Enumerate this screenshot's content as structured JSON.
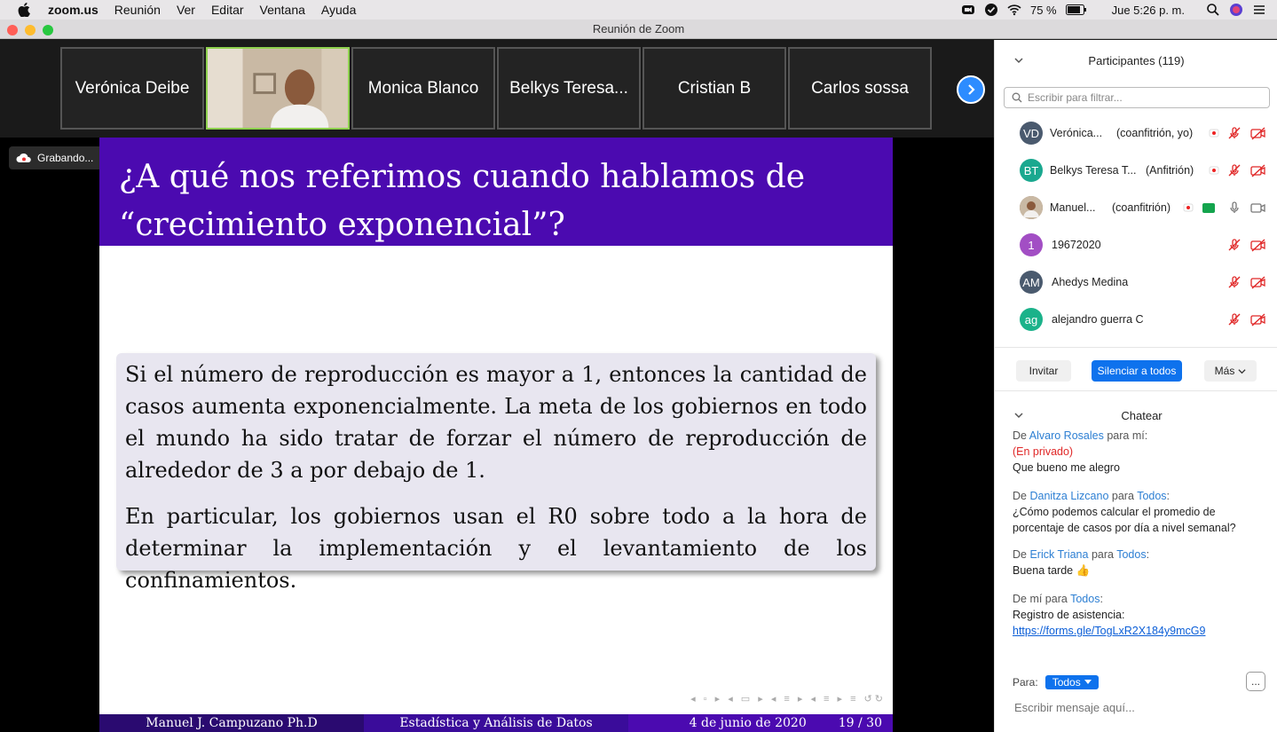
{
  "menubar": {
    "app": "zoom.us",
    "menus": [
      "Reunión",
      "Ver",
      "Editar",
      "Ventana",
      "Ayuda"
    ],
    "battery": "75 %",
    "clock": "Jue 5:26 p. m."
  },
  "window": {
    "title": "Reunión de Zoom"
  },
  "gallery": {
    "tiles": [
      "Verónica Deibe",
      "",
      "Monica Blanco",
      "Belkys Teresa...",
      "Cristian B",
      "Carlos sossa"
    ]
  },
  "recording": {
    "label": "Grabando..."
  },
  "slide": {
    "title_line1": "¿A qué nos referimos cuando hablamos de",
    "title_line2": "“crecimiento exponencial”?",
    "para1": "Si el número de reproducción es mayor a 1, entonces la cantidad de casos aumenta exponencialmente. La meta de los gobiernos en todo el mundo ha sido tratar de forzar el número de reproducción de alrededor de 3 a por debajo de 1.",
    "para2": "En particular, los gobiernos usan el R0 sobre todo a la hora de determinar la implementación y el levantamiento de los confinamientos.",
    "footer_author": "Manuel J. Campuzano Ph.D",
    "footer_course": "Estadística y Análisis de Datos",
    "footer_date": "4 de junio de 2020",
    "footer_page": "19 / 30"
  },
  "participants": {
    "title": "Participantes (119)",
    "filter_placeholder": "Escribir para filtrar...",
    "list": [
      {
        "initials": "VD",
        "name": "Verónica...",
        "role": "(coanfitrión, yo)",
        "color": "#4a5a6e"
      },
      {
        "initials": "BT",
        "name": "Belkys Teresa T...",
        "role": "(Anfitrión)",
        "color": "#1aa88f"
      },
      {
        "initials": "",
        "name": "Manuel...",
        "role": "(coanfitrión)",
        "color": "#8a6a50"
      },
      {
        "initials": "1",
        "name": "19672020",
        "role": "",
        "color": "#a24ec4"
      },
      {
        "initials": "AM",
        "name": "Ahedys Medina",
        "role": "",
        "color": "#4a5a6e"
      },
      {
        "initials": "ag",
        "name": "alejandro guerra C",
        "role": "",
        "color": "#1bb28a"
      }
    ],
    "invite": "Invitar",
    "mute_all": "Silenciar a todos",
    "more": "Más"
  },
  "chat": {
    "title": "Chatear",
    "messages": [
      {
        "prefix": "De",
        "from": "Alvaro Rosales",
        "to_text": "para mí:",
        "to": "",
        "private": "(En privado)",
        "text": "Que bueno me alegro"
      },
      {
        "prefix": "De",
        "from": "Danitza Lizcano",
        "to_text": "para",
        "to": "Todos",
        "text": "¿Cómo podemos calcular el promedio de porcentaje de casos por día a nivel semanal?"
      },
      {
        "prefix": "De",
        "from": "Erick Triana",
        "to_text": "para",
        "to": "Todos",
        "text": "Buena tarde 👍"
      },
      {
        "prefix": "De mí para",
        "to": "Todos",
        "text": "Registro de asistencia:",
        "link": "https://forms.gle/TogLxR2X184y9mcG9"
      }
    ],
    "para_label": "Para:",
    "recipient": "Todos",
    "more": "...",
    "input_placeholder": "Escribir mensaje aquí..."
  }
}
